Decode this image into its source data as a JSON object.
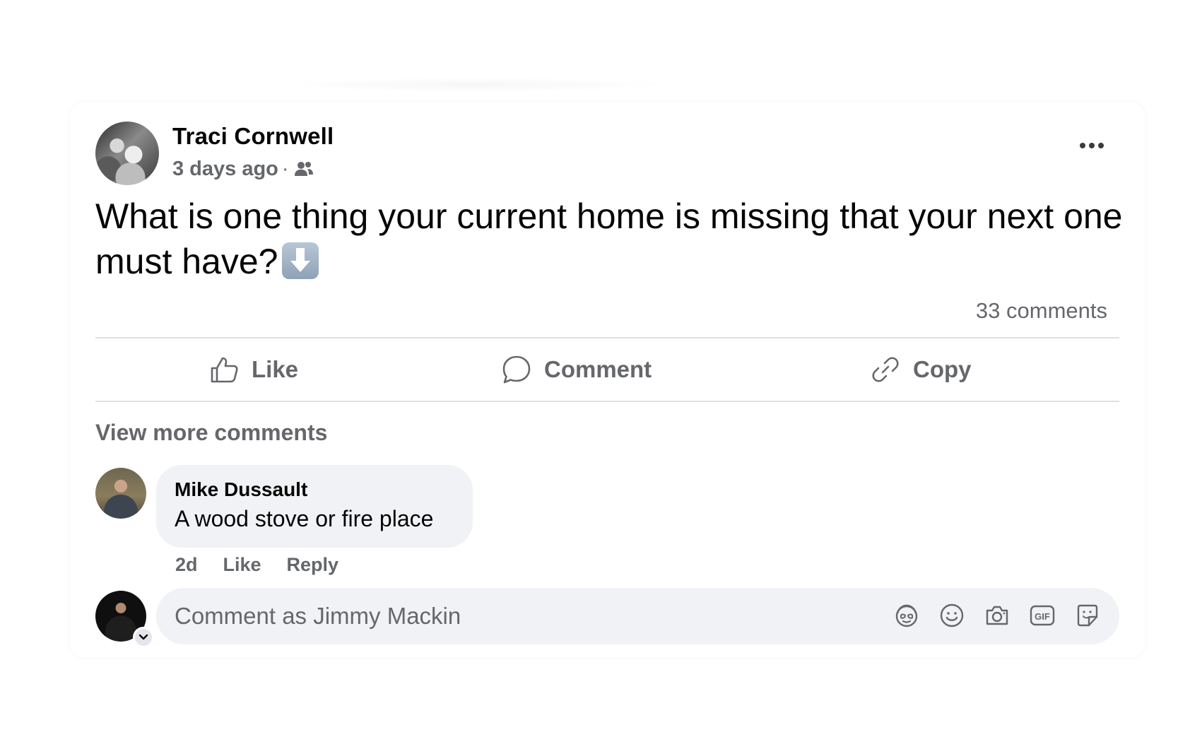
{
  "post": {
    "author": "Traci Cornwell",
    "time": "3 days ago",
    "separator": "·",
    "text": "What is one thing your current home is missing that your next one must have?",
    "comment_count": "33 comments"
  },
  "actions": {
    "like": "Like",
    "comment": "Comment",
    "copy": "Copy"
  },
  "comments": {
    "view_more": "View more comments",
    "items": [
      {
        "author": "Mike Dussault",
        "text": "A wood stove or fire place",
        "time": "2d",
        "like": "Like",
        "reply": "Reply"
      }
    ]
  },
  "composer": {
    "placeholder": "Comment as Jimmy Mackin",
    "icons": [
      "avatar-sticker-icon",
      "emoji-icon",
      "camera-icon",
      "gif-icon",
      "sticker-icon"
    ]
  },
  "icons": {
    "audience": "group-icon",
    "more": "more-options-icon",
    "emoji": "down-arrow-emoji"
  },
  "colors": {
    "text_primary": "#050505",
    "text_secondary": "#65676b",
    "bubble": "#f0f2f5",
    "divider": "#dddfe2"
  }
}
